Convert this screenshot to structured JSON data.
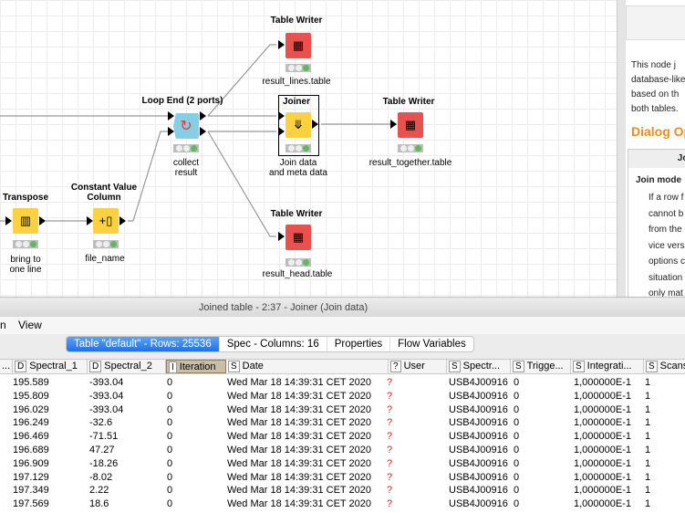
{
  "workflow": {
    "nodes": [
      {
        "id": "tw_lines",
        "title": "Table Writer",
        "caption": [
          "result_lines.table"
        ],
        "color": "#e9514f",
        "icon": "table-writer-icon"
      },
      {
        "id": "loop_end",
        "title": "Loop End (2 ports)",
        "caption": [
          "collect",
          "result"
        ],
        "color": "#86cde6",
        "icon": "loop-end-icon"
      },
      {
        "id": "joiner",
        "title": "Joiner",
        "caption": [
          "Join data",
          "and meta data"
        ],
        "color": "#fbd13f",
        "icon": "joiner-icon"
      },
      {
        "id": "tw_together",
        "title": "Table Writer",
        "caption": [
          "result_together.table"
        ],
        "color": "#e9514f",
        "icon": "table-writer-icon"
      },
      {
        "id": "transpose",
        "title": "Transpose",
        "caption": [
          "bring to",
          "one line"
        ],
        "color": "#fbd13f",
        "icon": "transpose-icon"
      },
      {
        "id": "const_col",
        "title": "Constant Value Column",
        "caption": [
          "file_name"
        ],
        "color": "#fbd13f",
        "icon": "constant-column-icon"
      },
      {
        "id": "tw_head",
        "title": "Table Writer",
        "caption": [
          "result_head.table"
        ],
        "color": "#e9514f",
        "icon": "table-writer-icon"
      }
    ],
    "node_status": "executed"
  },
  "description": {
    "text": "This node joins two tables in a database-like way. The join is based on the joining columns of both tables.",
    "visible_lines": [
      "This node j",
      "database-like",
      "based on th",
      "both tables."
    ],
    "dialog_heading": "Dialog Op",
    "box_header": "Joi",
    "join_mode_label": "Join mode",
    "join_mode_lines": [
      "If a row f",
      "cannot b",
      "from the",
      "vice vers",
      "options c",
      "situation",
      "only mat"
    ]
  },
  "window": {
    "title": "Joined table - 2:37 - Joiner (Join data)"
  },
  "menu": [
    "n",
    "View"
  ],
  "tabs": [
    {
      "label": "Table \"default\" - Rows: 25536",
      "active": true
    },
    {
      "label": "Spec - Columns: 16",
      "active": false
    },
    {
      "label": "Properties",
      "active": false
    },
    {
      "label": "Flow Variables",
      "active": false
    }
  ],
  "table": {
    "columns": [
      {
        "type": "",
        "name": "..."
      },
      {
        "type": "D",
        "name": "Spectral_1"
      },
      {
        "type": "D",
        "name": "Spectral_2"
      },
      {
        "type": "I",
        "name": "Iteration",
        "selected": true
      },
      {
        "type": "S",
        "name": "Date"
      },
      {
        "type": "?",
        "name": "User"
      },
      {
        "type": "S",
        "name": "Spectr..."
      },
      {
        "type": "S",
        "name": "Trigge..."
      },
      {
        "type": "S",
        "name": "Integrati..."
      },
      {
        "type": "S",
        "name": "Scans"
      }
    ],
    "rows": [
      [
        "195.589",
        "-393.04",
        "0",
        "Wed Mar 18 14:39:31 CET 2020",
        "?",
        "USB4J00916",
        "0",
        "1,000000E-1",
        "1"
      ],
      [
        "195.809",
        "-393.04",
        "0",
        "Wed Mar 18 14:39:31 CET 2020",
        "?",
        "USB4J00916",
        "0",
        "1,000000E-1",
        "1"
      ],
      [
        "196.029",
        "-393.04",
        "0",
        "Wed Mar 18 14:39:31 CET 2020",
        "?",
        "USB4J00916",
        "0",
        "1,000000E-1",
        "1"
      ],
      [
        "196.249",
        "-32.6",
        "0",
        "Wed Mar 18 14:39:31 CET 2020",
        "?",
        "USB4J00916",
        "0",
        "1,000000E-1",
        "1"
      ],
      [
        "196.469",
        "-71.51",
        "0",
        "Wed Mar 18 14:39:31 CET 2020",
        "?",
        "USB4J00916",
        "0",
        "1,000000E-1",
        "1"
      ],
      [
        "196.689",
        "47.27",
        "0",
        "Wed Mar 18 14:39:31 CET 2020",
        "?",
        "USB4J00916",
        "0",
        "1,000000E-1",
        "1"
      ],
      [
        "196.909",
        "-18.26",
        "0",
        "Wed Mar 18 14:39:31 CET 2020",
        "?",
        "USB4J00916",
        "0",
        "1,000000E-1",
        "1"
      ],
      [
        "197.129",
        "-8.02",
        "0",
        "Wed Mar 18 14:39:31 CET 2020",
        "?",
        "USB4J00916",
        "0",
        "1,000000E-1",
        "1"
      ],
      [
        "197.349",
        "2.22",
        "0",
        "Wed Mar 18 14:39:31 CET 2020",
        "?",
        "USB4J00916",
        "0",
        "1,000000E-1",
        "1"
      ],
      [
        "197.569",
        "18.6",
        "0",
        "Wed Mar 18 14:39:31 CET 2020",
        "?",
        "USB4J00916",
        "0",
        "1,000000E-1",
        "1"
      ]
    ]
  }
}
